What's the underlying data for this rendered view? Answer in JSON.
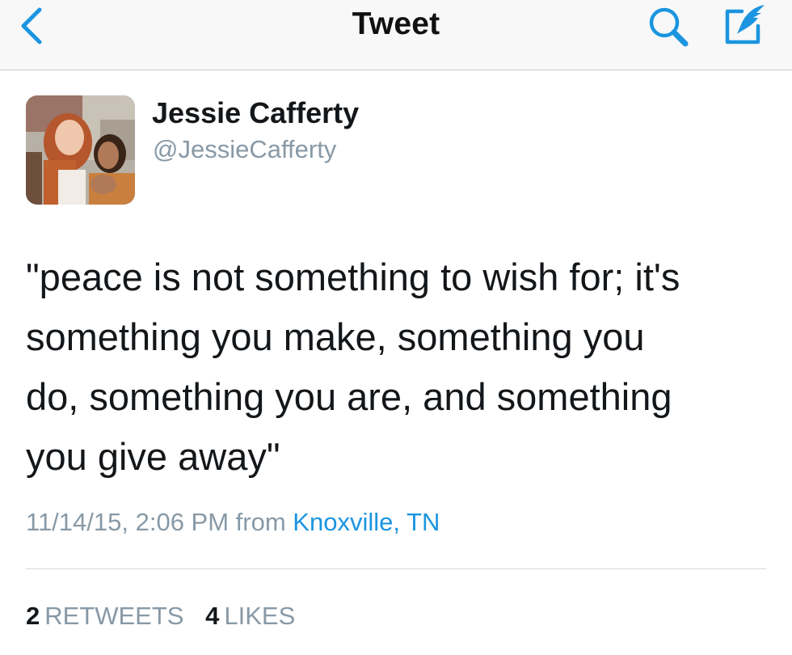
{
  "nav": {
    "title": "Tweet",
    "back_icon": "chevron-left-icon",
    "search_icon": "search-icon",
    "compose_icon": "compose-icon",
    "accent_color": "#1b95e0"
  },
  "tweet": {
    "display_name": "Jessie Cafferty",
    "handle": "@JessieCafferty",
    "text_lines": [
      "\"peace is not something to wish for; it's",
      "something you make, something you",
      "do, something you are, and something",
      "you give away\""
    ],
    "timestamp": "11/14/15, 2:06 PM",
    "from_label": "from",
    "location": "Knoxville, TN",
    "retweets": {
      "count": "2",
      "label": "RETWEETS"
    },
    "likes": {
      "count": "4",
      "label": "LIKES"
    }
  }
}
